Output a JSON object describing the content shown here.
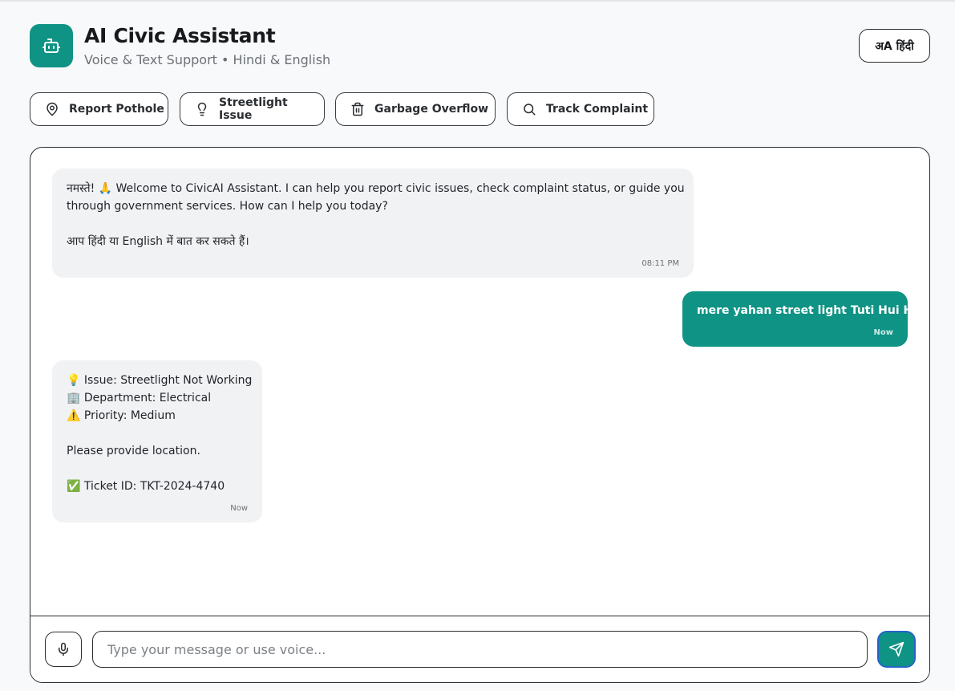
{
  "app": {
    "title": "AI Civic Assistant",
    "subtitle": "Voice & Text Support • Hindi & English",
    "language_toggle": "अA हिंदी",
    "logo_icon": "robot-icon",
    "accent_color": "#0f9384"
  },
  "quick_actions": [
    {
      "label": "Report Pothole",
      "icon": "map-pin-icon"
    },
    {
      "label": "Streetlight Issue",
      "icon": "lightbulb-icon"
    },
    {
      "label": "Garbage Overflow",
      "icon": "trash-icon"
    },
    {
      "label": "Track Complaint",
      "icon": "search-icon"
    }
  ],
  "messages": [
    {
      "sender": "bot",
      "lines": [
        "नमस्ते! 🙏 Welcome to CivicAI Assistant. I can help you report civic issues, check complaint status, or guide you",
        "through government services. How can I help you today?",
        "",
        "आप हिंदी या English में बात कर सकते हैं।"
      ],
      "time": "08:11 PM"
    },
    {
      "sender": "user",
      "lines": [
        "mere yahan street light Tuti Hui Hai"
      ],
      "time": "Now"
    },
    {
      "sender": "bot",
      "lines": [
        "💡 Issue: Streetlight Not Working",
        "🏢 Department: Electrical",
        "⚠️ Priority: Medium",
        "",
        "Please provide location.",
        "",
        "✅ Ticket ID: TKT-2024-4740"
      ],
      "time": "Now"
    }
  ],
  "composer": {
    "placeholder": "Type your message or use voice...",
    "value": "",
    "mic_icon": "microphone-icon",
    "send_icon": "send-icon"
  }
}
